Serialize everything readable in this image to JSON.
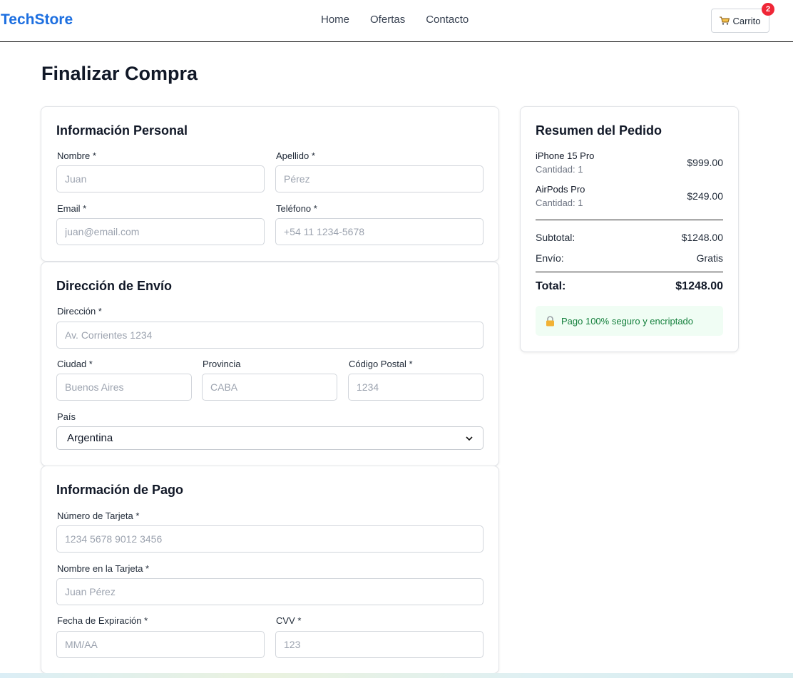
{
  "header": {
    "brand": "TechStore",
    "nav": [
      "Home",
      "Ofertas",
      "Contacto"
    ],
    "cart_label": "Carrito",
    "cart_count": "2"
  },
  "page_title": "Finalizar Compra",
  "personal": {
    "title": "Información Personal",
    "first_name": {
      "label": "Nombre *",
      "placeholder": "Juan"
    },
    "last_name": {
      "label": "Apellido *",
      "placeholder": "Pérez"
    },
    "email": {
      "label": "Email *",
      "placeholder": "juan@email.com"
    },
    "phone": {
      "label": "Teléfono *",
      "placeholder": "+54 11 1234-5678"
    }
  },
  "shipping": {
    "title": "Dirección de Envío",
    "address": {
      "label": "Dirección *",
      "placeholder": "Av. Corrientes 1234"
    },
    "city": {
      "label": "Ciudad *",
      "placeholder": "Buenos Aires"
    },
    "province": {
      "label": "Provincia",
      "placeholder": "CABA"
    },
    "postal": {
      "label": "Código Postal *",
      "placeholder": "1234"
    },
    "country": {
      "label": "País",
      "value": "Argentina"
    }
  },
  "payment": {
    "title": "Información de Pago",
    "card_number": {
      "label": "Número de Tarjeta *",
      "placeholder": "1234 5678 9012 3456"
    },
    "card_name": {
      "label": "Nombre en la Tarjeta *",
      "placeholder": "Juan Pérez"
    },
    "expiry": {
      "label": "Fecha de Expiración *",
      "placeholder": "MM/AA"
    },
    "cvv": {
      "label": "CVV *",
      "placeholder": "123"
    }
  },
  "summary": {
    "title": "Resumen del Pedido",
    "items": [
      {
        "name": "iPhone 15 Pro",
        "qty": "Cantidad: 1",
        "price": "$999.00"
      },
      {
        "name": "AirPods Pro",
        "qty": "Cantidad: 1",
        "price": "$249.00"
      }
    ],
    "subtotal_label": "Subtotal:",
    "subtotal_value": "$1248.00",
    "shipping_label": "Envío:",
    "shipping_value": "Gratis",
    "total_label": "Total:",
    "total_value": "$1248.00",
    "secure_text": "Pago 100% seguro y encriptado"
  },
  "icons": {
    "cart": "cart-icon",
    "lock": "lock-icon",
    "chevron": "chevron-down-icon"
  },
  "colors": {
    "brand": "#1d6fe0",
    "badge": "#ef2636",
    "secure_text": "#15803d",
    "secure_bg": "#f0fdf4"
  }
}
